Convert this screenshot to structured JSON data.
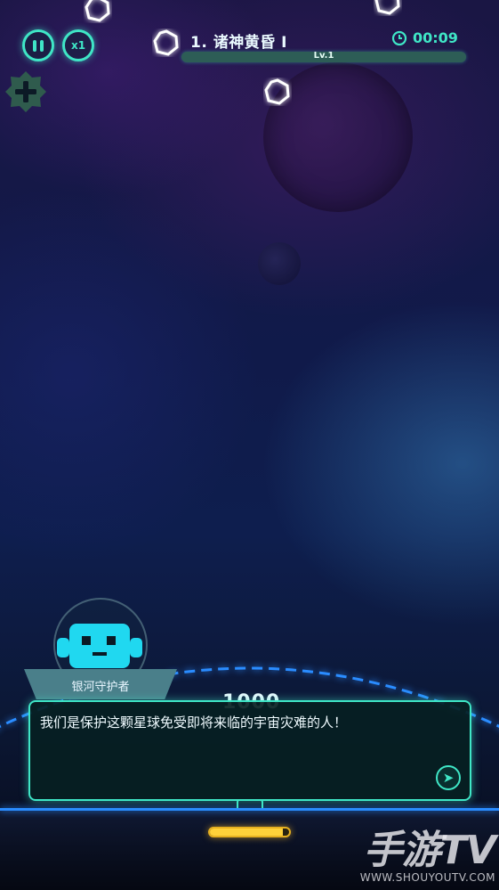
{
  "hud": {
    "speed_label": "x1",
    "level_title": "1. 诸神黄昏 I",
    "timer": "00:09",
    "level_bar_label": "Lv.1",
    "level_progress": 1.0
  },
  "icons": {
    "pause": "pause-icon",
    "speed": "speed-icon",
    "add": "plus-icon",
    "clock": "clock-icon",
    "next": "arrow-right-icon",
    "robot": "robot-icon"
  },
  "colors": {
    "accent": "#3fe6c6",
    "arc": "#2a8cff",
    "energy": "#ffd23a",
    "add_button": "#2f5b4d"
  },
  "score_ghost": "1000",
  "energy_level": 0.92,
  "dialog": {
    "speaker": "银河守护者",
    "text": "我们是保护这颗星球免受即将来临的宇宙灾难的人！"
  },
  "watermark": {
    "logo": "手游TV",
    "url": "WWW.SHOUYOUTV.COM"
  }
}
